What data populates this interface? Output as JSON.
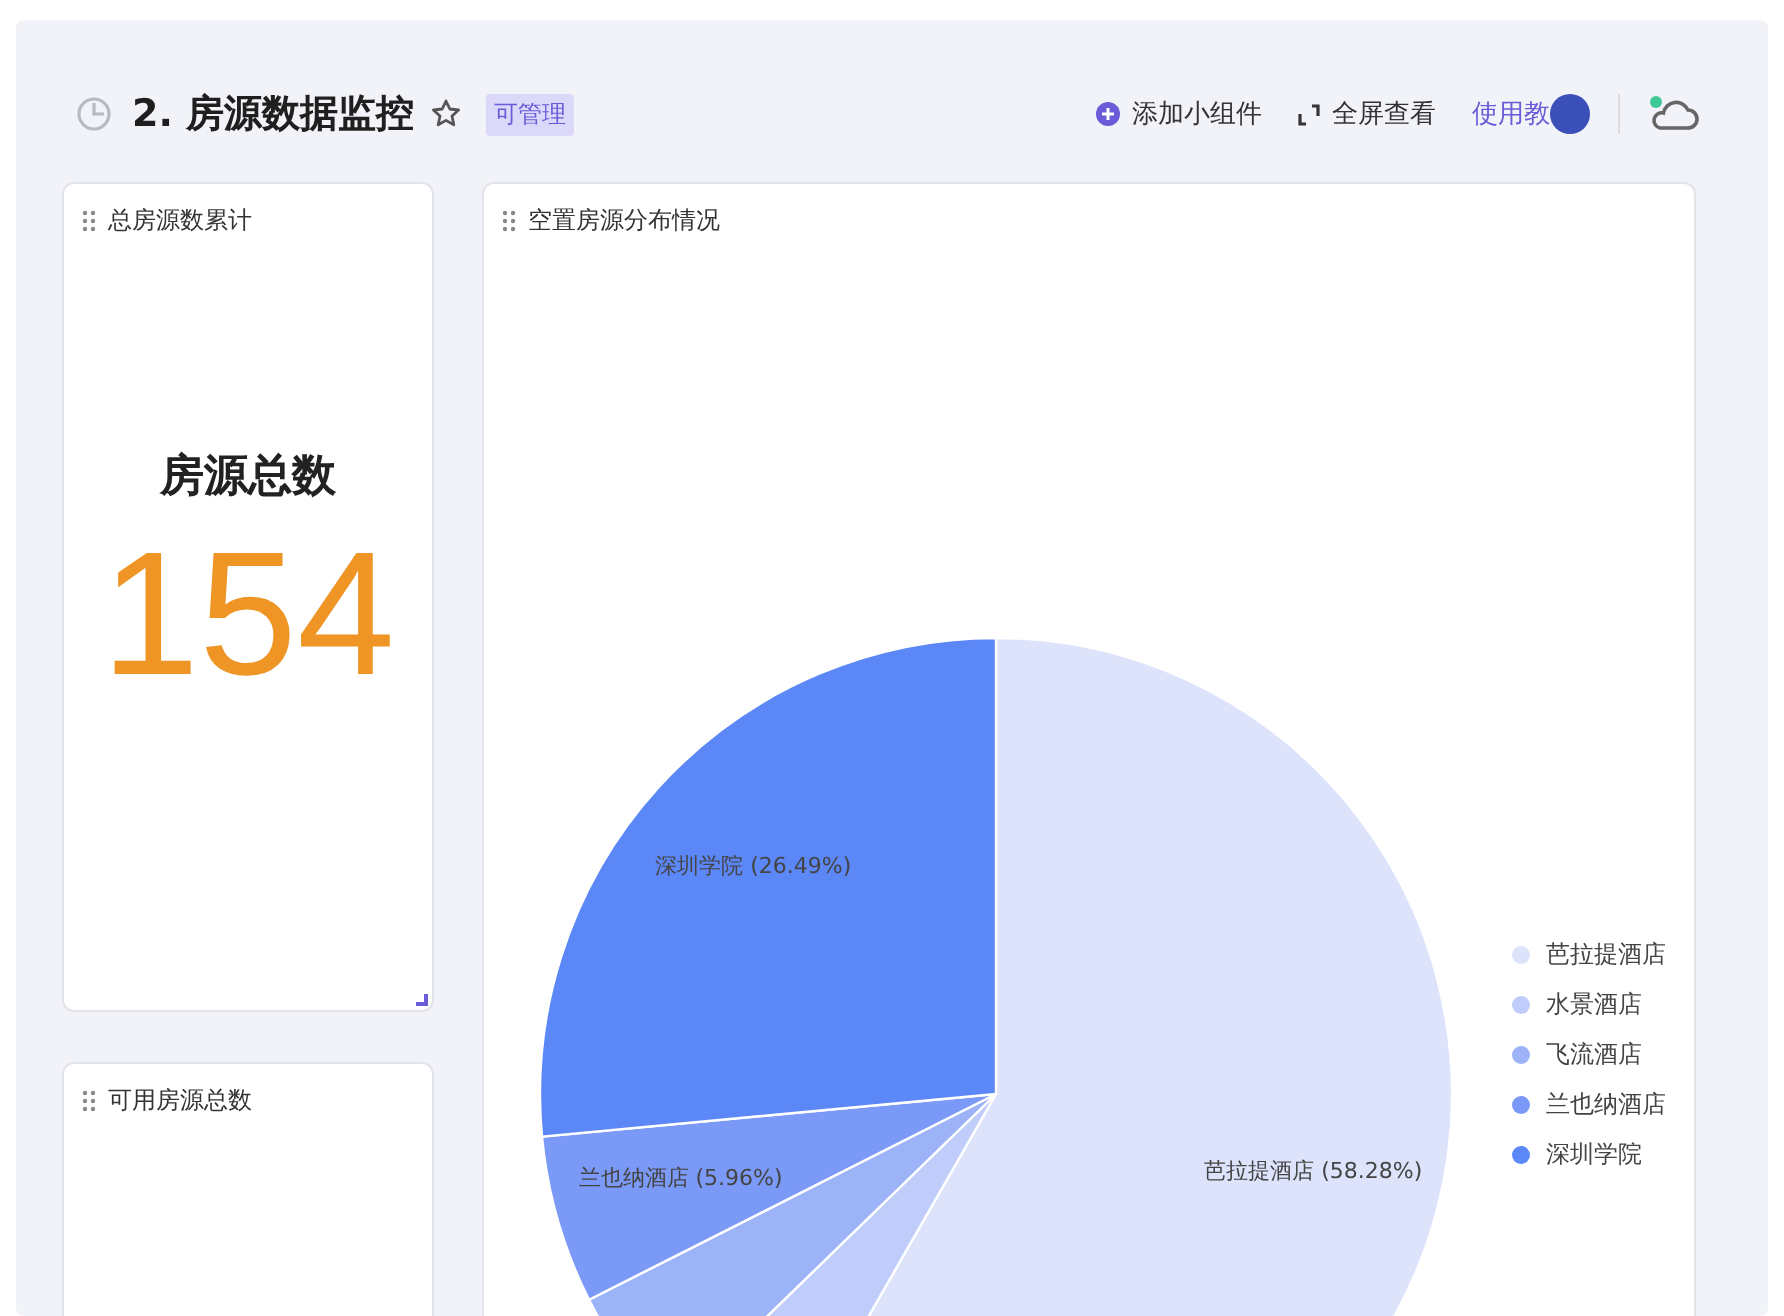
{
  "header": {
    "title": "2. 房源数据监控",
    "badge": "可管理",
    "actions": [
      {
        "kind": "add",
        "label": "添加小组件"
      },
      {
        "kind": "fullscreen",
        "label": "全屏查看"
      },
      {
        "kind": "link",
        "label": "使用教"
      }
    ]
  },
  "widgets": [
    {
      "kind": "stat",
      "title": "总房源数累计",
      "label": "房源总数",
      "value": "154"
    },
    {
      "kind": "stat",
      "title": "可用房源总数"
    },
    {
      "kind": "pie",
      "title": "空置房源分布情况",
      "chart_data": {
        "type": "pie",
        "categories": [
          "芭拉提酒店",
          "水景酒店",
          "飞流酒店",
          "兰也纳酒店",
          "深圳学院"
        ],
        "values": [
          58.28,
          4.45,
          4.82,
          5.96,
          26.49
        ],
        "legend": "right",
        "colors": [
          "#dde3fb",
          "#c0cdfa",
          "#9db3f8",
          "#7b99f6",
          "#5b87f7"
        ],
        "value_labels": [
          "芭拉提酒店 (58.28%)",
          null,
          null,
          "兰也纳酒店 (5.96%)",
          "深圳学院 (26.49%)"
        ]
      }
    }
  ]
}
